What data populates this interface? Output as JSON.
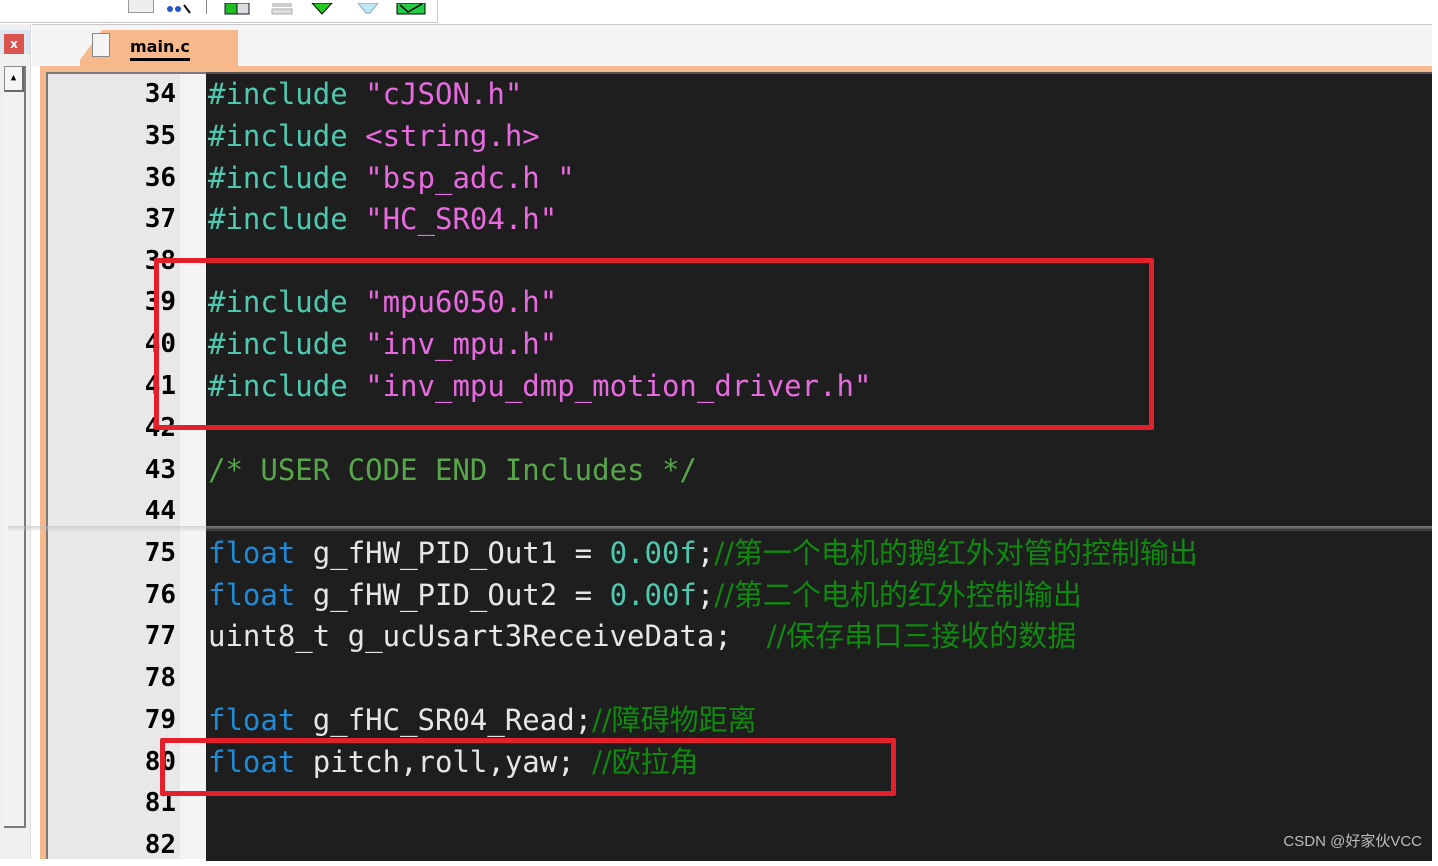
{
  "toolbar": {
    "icons": [
      "dropdown-icon",
      "hierarchy-icon",
      "window-split-icon",
      "window-stack-icon",
      "download-diamond-icon",
      "funnel-icon",
      "mail-check-icon"
    ]
  },
  "panel": {
    "close_label": "x",
    "scroll_up_glyph": "▲"
  },
  "editor": {
    "tab_label": "main.c",
    "lines": [
      {
        "n": "34",
        "tokens": [
          {
            "t": "#include ",
            "c": "kw-pre"
          },
          {
            "t": "\"cJSON.h\"",
            "c": "str"
          }
        ]
      },
      {
        "n": "35",
        "tokens": [
          {
            "t": "#include ",
            "c": "kw-pre"
          },
          {
            "t": "<string.h>",
            "c": "str"
          }
        ]
      },
      {
        "n": "36",
        "tokens": [
          {
            "t": "#include ",
            "c": "kw-pre"
          },
          {
            "t": "\"bsp_adc.h \"",
            "c": "str"
          }
        ]
      },
      {
        "n": "37",
        "tokens": [
          {
            "t": "#include ",
            "c": "kw-pre"
          },
          {
            "t": "\"HC_SR04.h\"",
            "c": "str"
          }
        ]
      },
      {
        "n": "38",
        "tokens": []
      },
      {
        "n": "39",
        "tokens": [
          {
            "t": "#include ",
            "c": "kw-pre"
          },
          {
            "t": "\"mpu6050.h\"",
            "c": "str"
          }
        ]
      },
      {
        "n": "40",
        "tokens": [
          {
            "t": "#include ",
            "c": "kw-pre"
          },
          {
            "t": "\"inv_mpu.h\"",
            "c": "str"
          }
        ]
      },
      {
        "n": "41",
        "tokens": [
          {
            "t": "#include ",
            "c": "kw-pre"
          },
          {
            "t": "\"inv_mpu_dmp_motion_driver.h\"",
            "c": "str"
          }
        ]
      },
      {
        "n": "42",
        "tokens": []
      },
      {
        "n": "43",
        "tokens": [
          {
            "t": "/* USER CODE END Includes */",
            "c": "cmt"
          }
        ]
      },
      {
        "n": "44",
        "tokens": []
      },
      {
        "n": "75",
        "tokens": [
          {
            "t": "float",
            "c": "type"
          },
          {
            "t": " g_fHW_PID_Out1 = ",
            "c": "ident"
          },
          {
            "t": "0.00f",
            "c": "num"
          },
          {
            "t": ";",
            "c": "ident"
          },
          {
            "t": "//第一个电机的鹅红外对管的控制输出",
            "c": "cmt-cn"
          }
        ]
      },
      {
        "n": "76",
        "tokens": [
          {
            "t": "float",
            "c": "type"
          },
          {
            "t": " g_fHW_PID_Out2 = ",
            "c": "ident"
          },
          {
            "t": "0.00f",
            "c": "num"
          },
          {
            "t": ";",
            "c": "ident"
          },
          {
            "t": "//第二个电机的红外控制输出",
            "c": "cmt-cn"
          }
        ]
      },
      {
        "n": "77",
        "tokens": [
          {
            "t": "uint8_t g_ucUsart3ReceiveData;  ",
            "c": "ident"
          },
          {
            "t": "//保存串口三接收的数据",
            "c": "cmt-cn"
          }
        ]
      },
      {
        "n": "78",
        "tokens": []
      },
      {
        "n": "79",
        "tokens": [
          {
            "t": "float",
            "c": "type"
          },
          {
            "t": " g_fHC_SR04_Read;",
            "c": "ident"
          },
          {
            "t": "//障碍物距离",
            "c": "cmt-cn"
          }
        ]
      },
      {
        "n": "80",
        "tokens": [
          {
            "t": "float",
            "c": "type"
          },
          {
            "t": " pitch,roll,yaw; ",
            "c": "ident"
          },
          {
            "t": "//欧拉角",
            "c": "cmt-cn"
          }
        ]
      },
      {
        "n": "81",
        "tokens": []
      },
      {
        "n": "82",
        "tokens": []
      }
    ]
  },
  "annotations": {
    "highlight_color": "#e4202a",
    "boxes": [
      "includes-mpu-box",
      "euler-angles-box"
    ]
  },
  "watermark": "CSDN @好家伙VCC"
}
